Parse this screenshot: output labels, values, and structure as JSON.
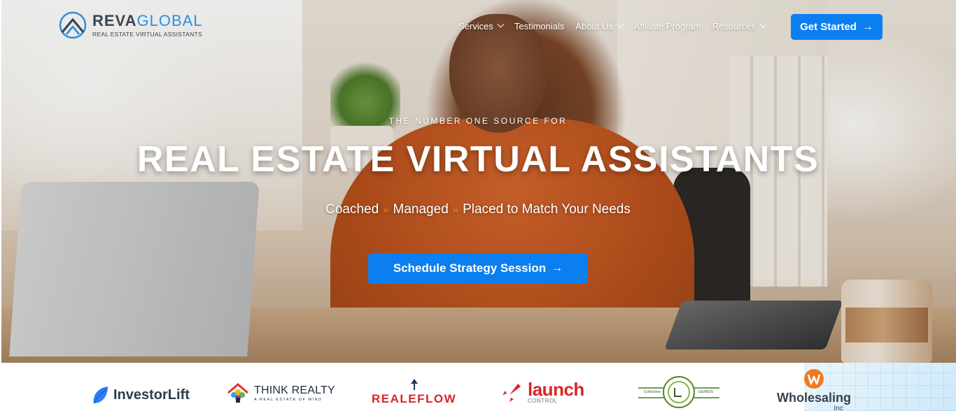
{
  "brand": {
    "name_bold": "REVA",
    "name_light": "GLOBAL",
    "tagline": "REAL ESTATE VIRTUAL ASSISTANTS",
    "accent_color": "#0b7ff0"
  },
  "nav": {
    "items": [
      {
        "label": "Services",
        "has_dropdown": true
      },
      {
        "label": "Testimonials",
        "has_dropdown": false
      },
      {
        "label": "About Us",
        "has_dropdown": true
      },
      {
        "label": "Affiliate Program",
        "has_dropdown": false
      },
      {
        "label": "Resources",
        "has_dropdown": true
      }
    ],
    "cta_label": "Get Started",
    "cta_icon": "arrow-right-icon"
  },
  "hero": {
    "eyebrow": "THE NUMBER ONE SOURCE FOR",
    "headline": "REAL ESTATE VIRTUAL ASSISTANTS",
    "sub_parts": [
      "Coached",
      "Managed",
      "Placed to Match Your Needs"
    ],
    "separator": "»",
    "cta_label": "Schedule Strategy Session",
    "cta_icon": "arrow-right-icon",
    "separator_color": "#f08a24"
  },
  "partners": {
    "investorlift": "InvestorLift",
    "think_realty": "THINK REALTY",
    "think_realty_tag": "A REAL ESTATE OF MIND",
    "realeflow": "REALEFLOW",
    "launch": "launch",
    "launch_sub": "CONTROL",
    "collective_left": "Collective",
    "collective_right": "GENIUS",
    "wholesaling": "Wholesaling",
    "wholesaling_sub": "Inc"
  }
}
